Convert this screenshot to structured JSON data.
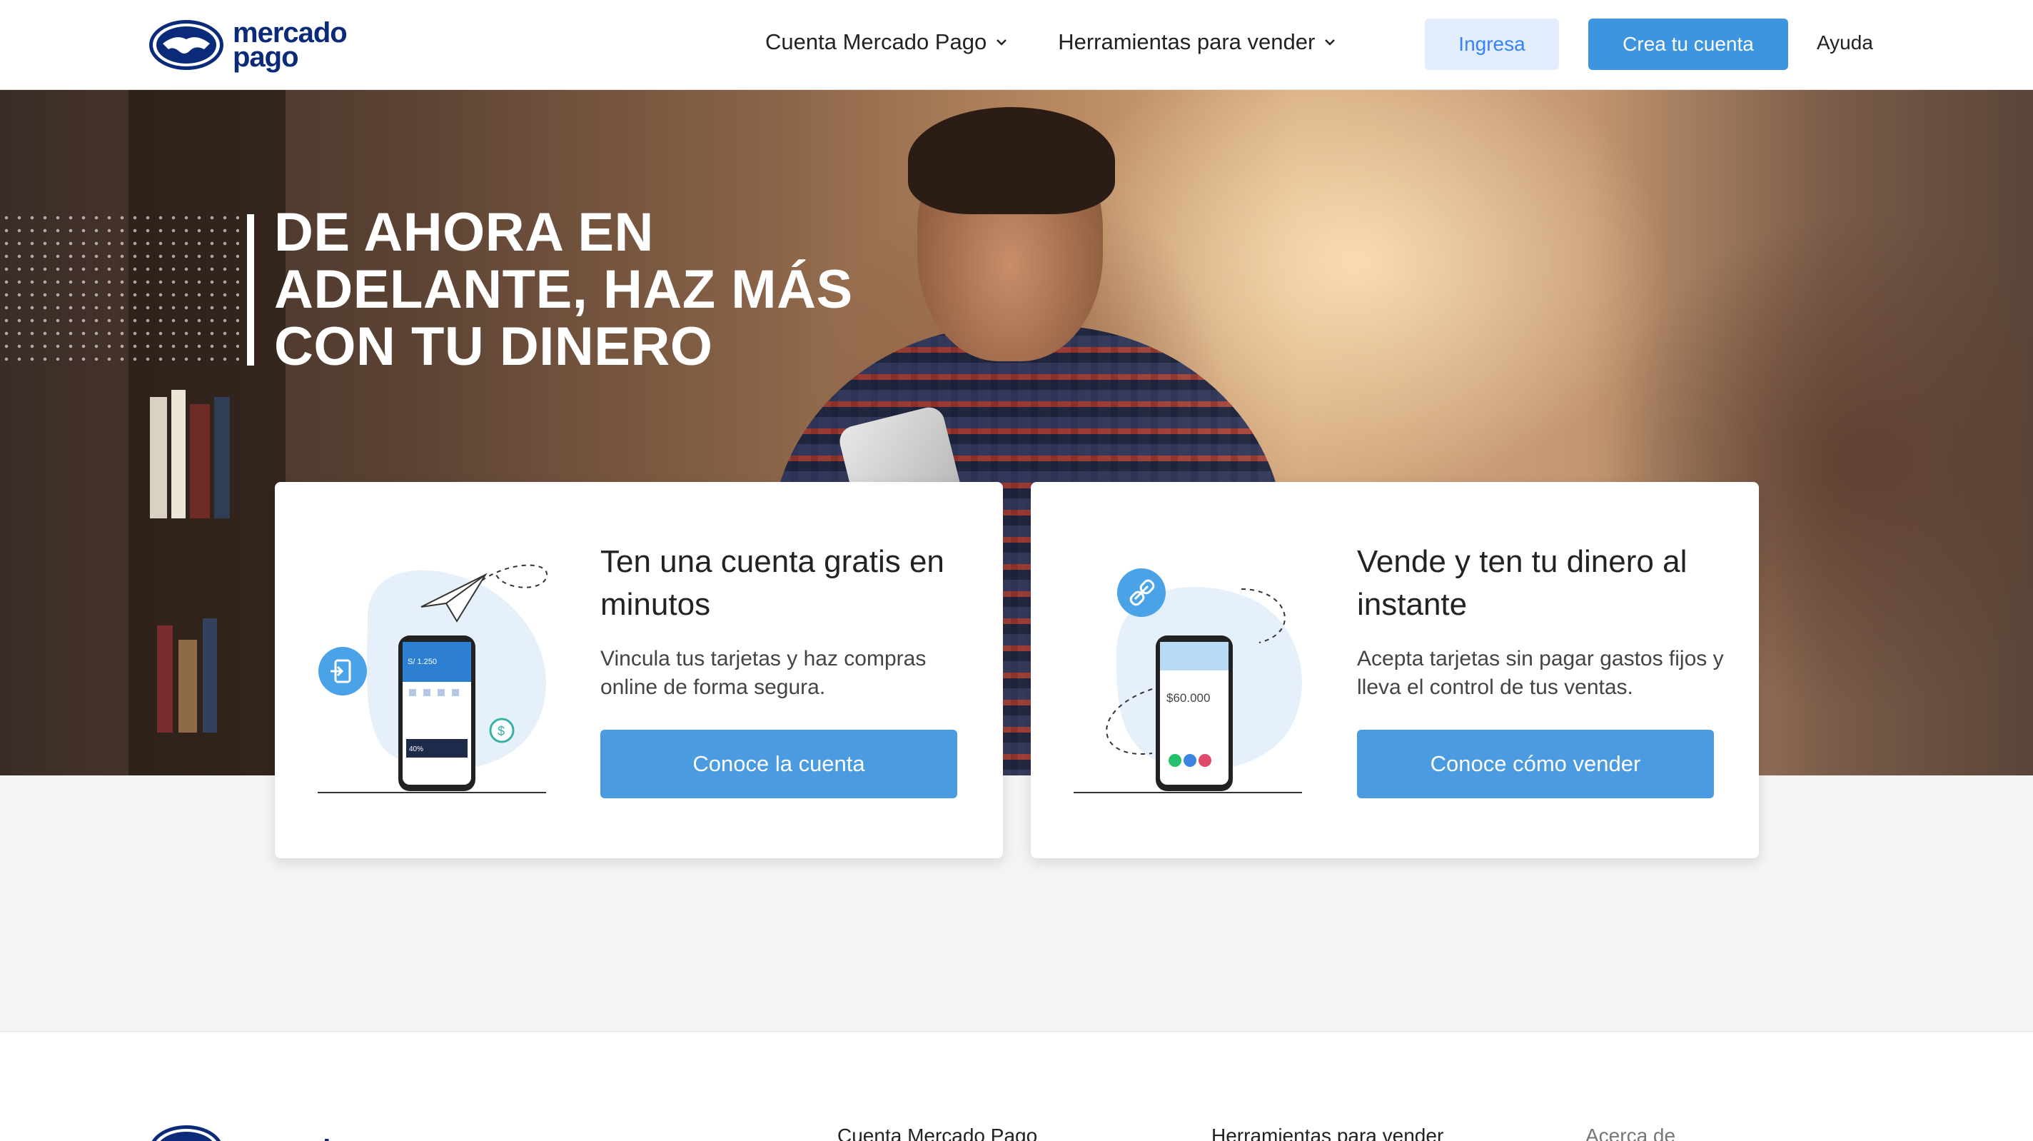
{
  "header": {
    "logo_line1": "mercado",
    "logo_line2": "pago",
    "nav": [
      {
        "label": "Cuenta Mercado Pago"
      },
      {
        "label": "Herramientas para vender"
      }
    ],
    "login_label": "Ingresa",
    "signup_label": "Crea tu cuenta",
    "help_label": "Ayuda"
  },
  "hero": {
    "title_line1": "DE AHORA EN",
    "title_line2": "ADELANTE, HAZ MÁS",
    "title_line3": "CON TU DINERO"
  },
  "cards": [
    {
      "title": "Ten una cuenta gratis en minutos",
      "description": "Vincula tus tarjetas y haz compras online de forma segura.",
      "button": "Conoce la cuenta",
      "phone_balance": "S/ 1.250",
      "phone_promo": "40%"
    },
    {
      "title": "Vende y ten tu dinero al instante",
      "description": "Acepta tarjetas sin pagar gastos fijos y lleva el control de tus ventas.",
      "button": "Conoce cómo vender",
      "phone_amount": "$60.000"
    }
  ],
  "footer": {
    "logo_line1": "mercado",
    "columns": [
      "Cuenta Mercado Pago",
      "Herramientas para vender",
      "Acerca de"
    ]
  },
  "colors": {
    "primary": "#3d95e0",
    "brand_navy": "#0b2b7a",
    "light_blue": "#e3edfb"
  }
}
